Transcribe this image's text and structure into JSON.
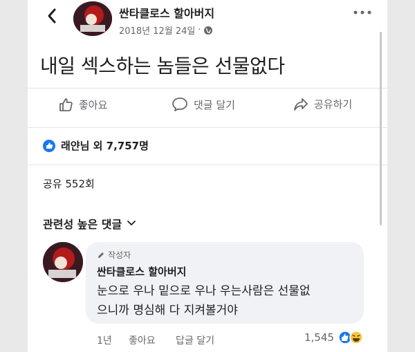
{
  "header": {
    "author": "싼타클로스 할아버지",
    "date": "2018년 12월 24일",
    "separator": "·"
  },
  "post": {
    "text": "내일 섹스하는 놈들은 선물없다"
  },
  "actions": {
    "like": "좋아요",
    "comment": "댓글 달기",
    "share": "공유하기"
  },
  "reactions": {
    "summary": "래얀님 외 7,757명"
  },
  "shares": {
    "text": "공유 552회"
  },
  "sort": {
    "label": "관련성 높은 댓글"
  },
  "comment": {
    "badge": "작성자",
    "author": "싼타클로스 할아버지",
    "line1": "눈으로 우나 밑으로 우나 우는사람은 선물없",
    "line2": "으니까 명심해 다 지켜볼거야",
    "time": "1년",
    "like": "좋아요",
    "reply": "답글 달기",
    "reaction_count": "1,545"
  },
  "colors": {
    "facebook_blue": "#1877f2",
    "text_primary": "#1c1e21",
    "text_secondary": "#65676b",
    "bubble_bg": "#f0f2f5"
  },
  "icons": [
    "back-arrow-icon",
    "avatar",
    "globe-icon",
    "more-icon",
    "like-thumb-icon",
    "comment-icon",
    "share-icon",
    "like-badge-icon",
    "chevron-down-icon",
    "pencil-icon",
    "laugh-emoji-icon"
  ]
}
